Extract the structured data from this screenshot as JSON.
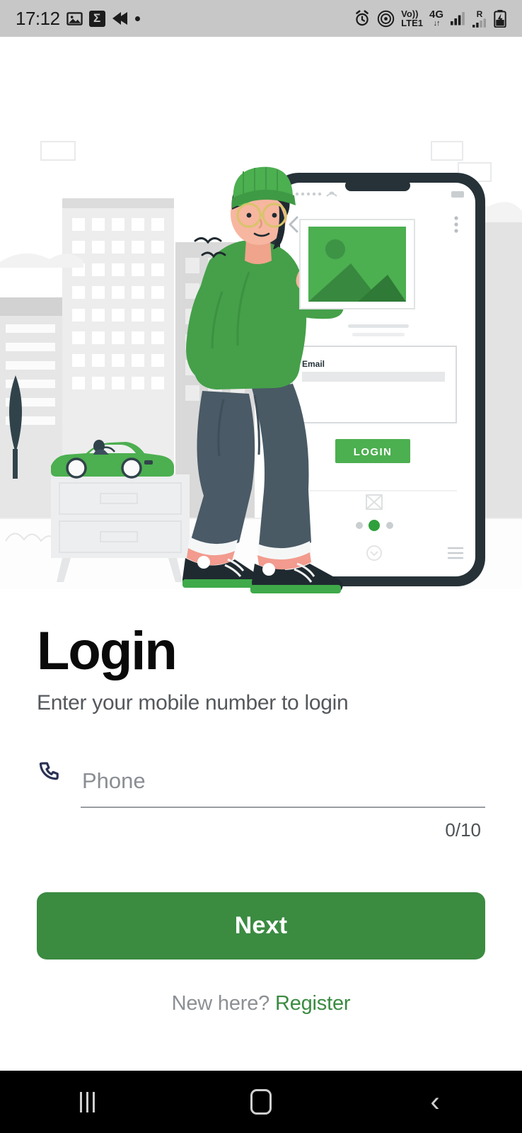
{
  "status_bar": {
    "time": "17:12",
    "left_icons": [
      "image-icon",
      "sigma-icon",
      "rewind-icon",
      "dot-icon"
    ],
    "volte_top": "Vo))",
    "volte_bottom": "LTE1",
    "network": "4G",
    "network_arrows": "↓↑",
    "roaming": "R",
    "right_icons": [
      "alarm-icon",
      "hotspot-icon",
      "volte-icon",
      "network-4g-icon",
      "signal-icon",
      "roaming-signal-icon",
      "battery-charging-icon"
    ],
    "background_color": "#c7c7c7"
  },
  "illustration": {
    "alt": "person holding a photo next to a large smartphone in a city scene",
    "phone_screen": {
      "field_label": "Email",
      "button_label": "LOGIN",
      "back_icon": "chevron-left-icon",
      "menu_icon": "more-vertical-icon",
      "active_dot_index": 1,
      "dot_count": 3
    },
    "colors": {
      "green": "#45a049",
      "dark": "#263238",
      "skin": "#f7b6a0",
      "denim": "#4a5a66",
      "grey": "#e4e6e7"
    }
  },
  "main": {
    "title": "Login",
    "subtitle": "Enter your mobile number to login",
    "phone_field": {
      "icon": "phone-icon",
      "placeholder": "Phone",
      "value": "",
      "counter": "0/10",
      "max_length": 10
    },
    "next_label": "Next",
    "register_prefix": "New here? ",
    "register_label": "Register",
    "accent_color": "#3b8b41"
  },
  "nav_bar": {
    "recents_label": "recents-icon",
    "home_label": "home-icon",
    "back_label": "back-icon"
  }
}
